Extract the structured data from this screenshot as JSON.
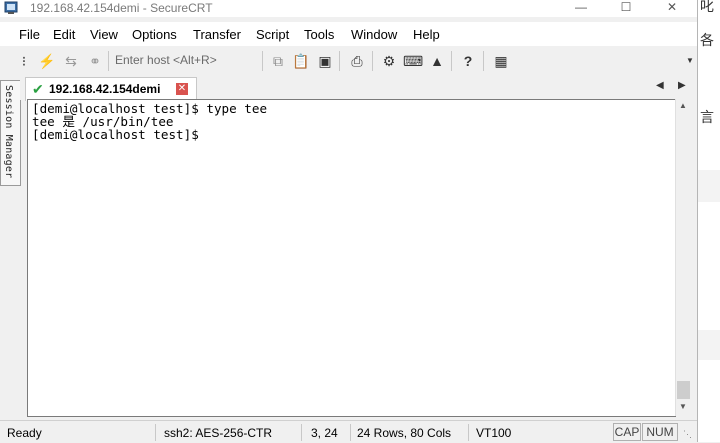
{
  "window": {
    "title": "192.168.42.154demi - SecureCRT",
    "minimize_icon": "minimize-icon",
    "maximize_icon": "maximize-icon",
    "close_icon": "close-icon"
  },
  "menubar": {
    "items": [
      "File",
      "Edit",
      "View",
      "Options",
      "Transfer",
      "Script",
      "Tools",
      "Window",
      "Help"
    ]
  },
  "toolbar": {
    "quick_connect_placeholder": "Enter host <Alt+R>",
    "icons": [
      "connect-icon",
      "lightning-icon",
      "reconnect-icon",
      "disconnect-icon",
      "copy-icon",
      "paste-icon",
      "find-icon",
      "print-icon",
      "settings-icon",
      "keymap-icon",
      "sftp-icon",
      "help-icon",
      "session-options-icon"
    ]
  },
  "session_manager": {
    "label": "Session Manager"
  },
  "tabs": [
    {
      "label": "192.168.42.154demi",
      "status_icon": "check-icon",
      "close_icon": "close-icon"
    }
  ],
  "terminal": {
    "lines": [
      "[demi@localhost test]$ type tee",
      "tee 是 /usr/bin/tee",
      "[demi@localhost test]$ "
    ]
  },
  "statusbar": {
    "ready": "Ready",
    "encryption": "ssh2: AES-256-CTR",
    "cursor_pos": "3,  24",
    "size": "24 Rows, 80 Cols",
    "terminal_type": "VT100",
    "cap": "CAP",
    "num": "NUM"
  },
  "background_window": {
    "glyphs": [
      "叱",
      "各",
      "言"
    ]
  },
  "colors": {
    "tab_check": "#2aa042",
    "tab_close": "#d9534f",
    "window_bg": "#f0f0f0"
  }
}
